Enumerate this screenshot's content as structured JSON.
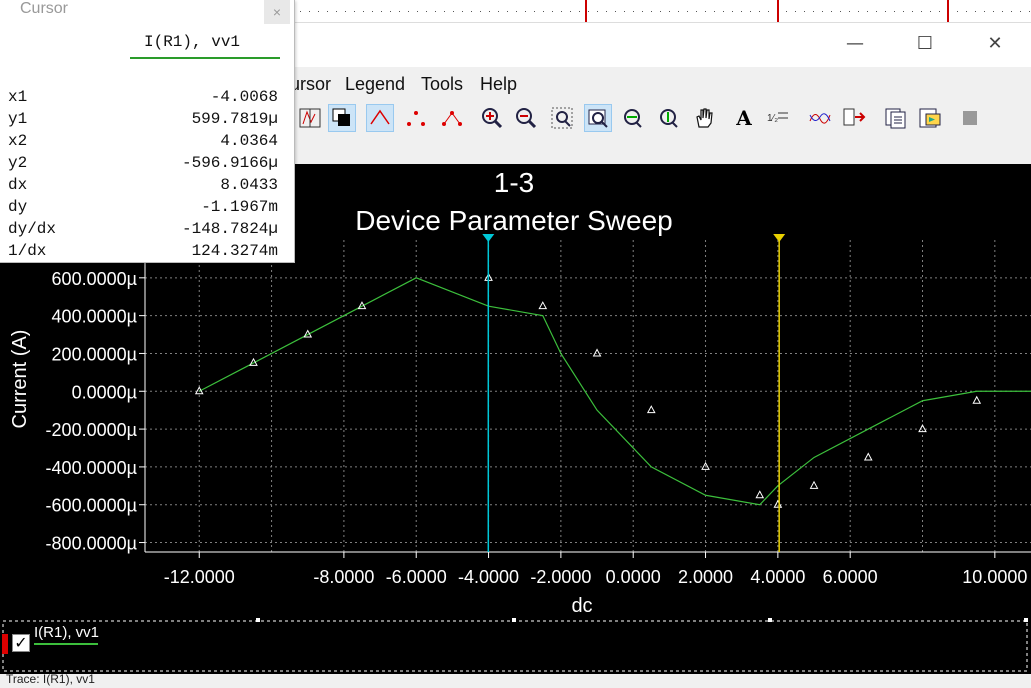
{
  "window": {
    "minimize_icon": "—",
    "maximize_icon": "☐",
    "close_icon": "✕"
  },
  "menu": {
    "items": [
      "ursor",
      "Legend",
      "Tools",
      "Help"
    ]
  },
  "cursor_panel": {
    "title": "Cursor",
    "close": "×",
    "trace": "I(R1), vv1",
    "rows": [
      {
        "label": "x1",
        "value": "-4.0068"
      },
      {
        "label": "y1",
        "value": "599.7819µ"
      },
      {
        "label": "x2",
        "value": "4.0364"
      },
      {
        "label": "y2",
        "value": "-596.9166µ"
      },
      {
        "label": "dx",
        "value": "8.0433"
      },
      {
        "label": "dy",
        "value": "-1.1967m"
      },
      {
        "label": "dy/dx",
        "value": "-148.7824µ"
      },
      {
        "label": "1/dx",
        "value": "124.3274m"
      }
    ]
  },
  "legend": {
    "label": "I(R1), vv1",
    "checked": true
  },
  "status": {
    "text": "Trace: I(R1), vv1"
  },
  "colors": {
    "trace": "#3cbf3c",
    "cursor1": "#00c8d8",
    "cursor2": "#e8d000",
    "grid": "#808080",
    "background": "#000000"
  },
  "chart_data": {
    "type": "line",
    "title": "1-3",
    "subtitle": "Device Parameter Sweep",
    "xlabel": "dc",
    "ylabel": "Current (A)",
    "xlim": [
      -13.5,
      11.0
    ],
    "ylim": [
      -850,
      800
    ],
    "y_unit": "µ",
    "x_ticks": [
      "-12.0000",
      "-8.0000",
      "-6.0000",
      "-4.0000",
      "-2.0000",
      "0.0000",
      "2.0000",
      "4.0000",
      "6.0000",
      "10.0000"
    ],
    "x_tick_values": [
      -12,
      -8,
      -6,
      -4,
      -2,
      0,
      2,
      4,
      6,
      10
    ],
    "y_ticks": [
      "600.0000µ",
      "400.0000µ",
      "200.0000µ",
      "0.0000µ",
      "-200.0000µ",
      "-400.0000µ",
      "-600.0000µ",
      "-800.0000µ"
    ],
    "y_tick_values": [
      600,
      400,
      200,
      0,
      -200,
      -400,
      -600,
      -800
    ],
    "series": [
      {
        "name": "I(R1), vv1",
        "x": [
          -12,
          -10.5,
          -9,
          -7.5,
          -6,
          -4,
          -2.5,
          -2,
          -1,
          0.5,
          2,
          3.5,
          4,
          5,
          6.5,
          8,
          9.5,
          11
        ],
        "y": [
          0,
          150,
          300,
          450,
          600,
          450,
          400,
          200,
          -100,
          -400,
          -550,
          -600,
          -500,
          -350,
          -200,
          -50,
          0,
          0
        ]
      }
    ],
    "markers": {
      "x": [
        -12,
        -10.5,
        -9,
        -7.5,
        -4,
        -2.5,
        -1,
        0.5,
        2,
        3.5,
        4,
        5,
        6.5,
        8,
        9.5
      ],
      "y": [
        0,
        150,
        300,
        450,
        600,
        450,
        200,
        -100,
        -400,
        -550,
        -600,
        -500,
        -350,
        -200,
        -50
      ]
    },
    "cursors": [
      -4.0068,
      4.0364
    ],
    "grid": true
  }
}
